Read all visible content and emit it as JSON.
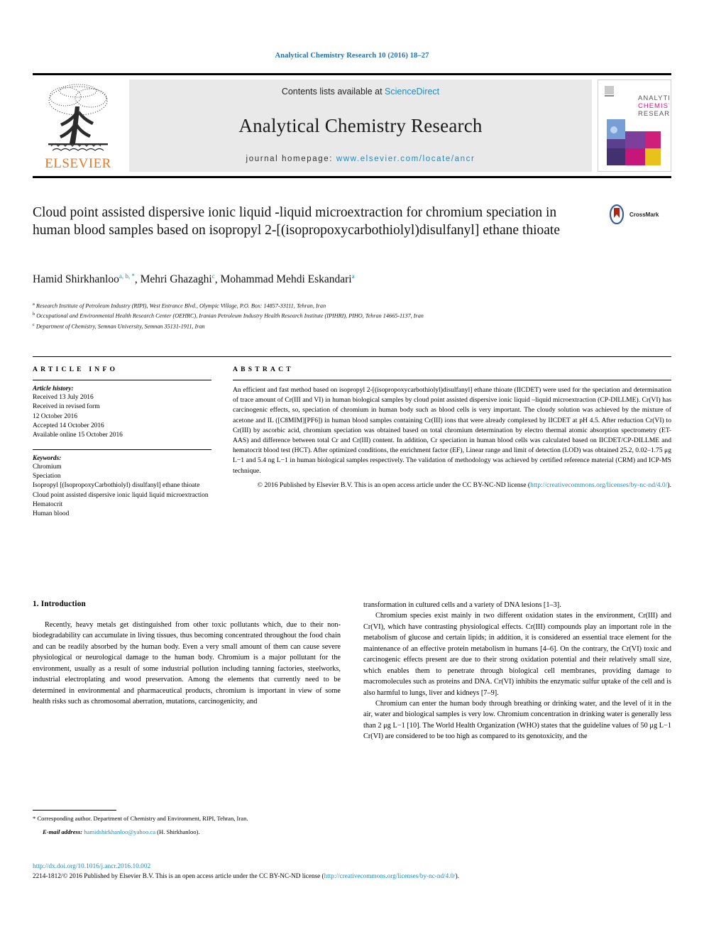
{
  "running_head": "Analytical Chemistry Research 10 (2016) 18–27",
  "masthead": {
    "publisher_name": "ELSEVIER",
    "contents_prefix": "Contents lists available at ",
    "contents_link": "ScienceDirect",
    "journal_title": "Analytical Chemistry Research",
    "homepage_prefix": "journal homepage: ",
    "homepage_url": "www.elsevier.com/locate/ancr",
    "cover": {
      "line1": "ANALYTICAL",
      "line2": "CHEMISTRY",
      "line3": "RESEARCH"
    }
  },
  "article": {
    "title": "Cloud point assisted dispersive ionic liquid -liquid microextraction for chromium speciation in human blood samples based on isopropyl 2-[(isopropoxycarbothiolyl)disulfanyl] ethane thioate",
    "crossmark_label": "CrossMark",
    "authors": [
      {
        "name": "Hamid Shirkhanloo",
        "marks": "a, b, *"
      },
      {
        "name": "Mehri Ghazaghi",
        "marks": "c"
      },
      {
        "name": "Mohammad Mehdi Eskandari",
        "marks": "a"
      }
    ],
    "affiliations": [
      {
        "mark": "a",
        "text": "Research Institute of Petroleum Industry (RIPI), West Entrance Blvd., Olympic Village, P.O. Box: 14857-33111, Tehran, Iran"
      },
      {
        "mark": "b",
        "text": "Occupational and Environmental Health Research Center (OEHRC), Iranian Petroleum Industry Health Research Institute (IPIHRI), PIHO, Tehran 14665-1137, Iran"
      },
      {
        "mark": "c",
        "text": "Department of Chemistry, Semnan University, Semnan 35131-1911, Iran"
      }
    ]
  },
  "article_info": {
    "heading": "ARTICLE INFO",
    "history_label": "Article history:",
    "history": [
      "Received 13 July 2016",
      "Received in revised form",
      "12 October 2016",
      "Accepted 14 October 2016",
      "Available online 15 October 2016"
    ],
    "keywords_label": "Keywords:",
    "keywords": [
      "Chromium",
      "Speciation",
      "Isopropyl [(IsopropoxyCarbothiolyl) disulfanyl] ethane thioate",
      "Cloud point assisted dispersive ionic liquid liquid microextraction",
      "Hematocrit",
      "Human blood"
    ]
  },
  "abstract": {
    "heading": "ABSTRACT",
    "body": "An efficient and fast method based on isopropyl 2-[(isopropoxycarbothiolyl)disulfanyl] ethane thioate (IICDET) were used for the speciation and determination of trace amount of Cr(III and VI) in human biological samples by cloud point assisted dispersive ionic liquid –liquid microextraction (CP-DILLME). Cr(VI) has carcinogenic effects, so, speciation of chromium in human body such as blood cells is very important. The cloudy solution was achieved by the mixture of acetone and IL ([C8MIM][PF6]) in human blood samples containing Cr(III) ions that were already complexed by IICDET at pH 4.5. After reduction Cr(VI) to Cr(III) by ascorbic acid, chromium speciation was obtained based on total chromium determination by electro thermal atomic absorption spectrometry (ET-AAS) and difference between total Cr and Cr(III) content. In addition, Cr speciation in human blood cells was calculated based on IICDET/CP-DILLME and hematocrit blood test (HCT). After optimized conditions, the enrichment factor (EF), Linear range and limit of detection (LOD) was obtained 25.2, 0.02–1.75 μg L−1 and 5.4 ng L−1 in human biological samples respectively. The validation of methodology was achieved by certified reference material (CRM) and ICP-MS technique.",
    "copyright_text": "© 2016 Published by Elsevier B.V. This is an open access article under the CC BY-NC-ND license (",
    "copyright_link": "http://creativecommons.org/licenses/by-nc-nd/4.0/",
    "copyright_tail": ")."
  },
  "introduction": {
    "heading": "1. Introduction",
    "left_paragraphs": [
      "Recently, heavy metals get distinguished from other toxic pollutants which, due to their non-biodegradability can accumulate in living tissues, thus becoming concentrated throughout the food chain and can be readily absorbed by the human body. Even a very small amount of them can cause severe physiological or neurological damage to the human body. Chromium is a major pollutant for the environment, usually as a result of some industrial pollution including tanning factories, steelworks, industrial electroplating and wood preservation. Among the elements that currently need to be determined in environmental and pharmaceutical products, chromium is important in view of some health risks such as chromosomal aberration, mutations, carcinogenicity, and"
    ],
    "right_continuation": "transformation in cultured cells and a variety of DNA lesions [1–3].",
    "right_paragraphs": [
      "Chromium species exist mainly in two different oxidation states in the environment, Cr(III) and Cr(VI), which have contrasting physiological effects. Cr(III) compounds play an important role in the metabolism of glucose and certain lipids; in addition, it is considered an essential trace element for the maintenance of an effective protein metabolism in humans [4–6]. On the contrary, the Cr(VI) toxic and carcinogenic effects present are due to their strong oxidation potential and their relatively small size, which enables them to penetrate through biological cell membranes, providing damage to macromolecules such as proteins and DNA. Cr(VI) inhibits the enzymatic sulfur uptake of the cell and is also harmful to lungs, liver and kidneys [7–9].",
      "Chromium can enter the human body through breathing or drinking water, and the level of it in the air, water and biological samples is very low. Chromium concentration in drinking water is generally less than 2 μg L−1 [10]. The World Health Organization (WHO) states that the guideline values of 50 μg L−1 Cr(VI) are considered to be too high as compared to its genotoxicity, and the"
    ]
  },
  "footnote": {
    "corresponding": "* Corresponding author. Department of Chemistry and Environment, RIPI, Tehran, Iran.",
    "email_label": "E-mail address:",
    "email": "hamidshirkhanloo@yahoo.ca",
    "email_owner": "(H. Shirkhanloo)."
  },
  "page_footer": {
    "doi": "http://dx.doi.org/10.1016/j.ancr.2016.10.002",
    "issn_prefix": "2214-1812/© 2016 Published by Elsevier B.V. This is an open access article under the CC BY-NC-ND license (",
    "issn_link": "http://creativecommons.org/licenses/by-nc-nd/4.0/",
    "issn_tail": ")."
  },
  "colors": {
    "link_blue": "#1f8ac0",
    "running_head_blue": "#1f6fb5",
    "elsevier_orange": "#E87722",
    "masthead_grey": "#e9e9e9",
    "crossmark_red": "#b02418"
  }
}
